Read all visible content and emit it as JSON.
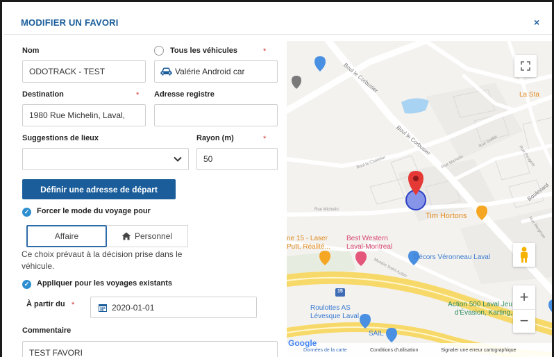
{
  "dialog": {
    "title": "MODIFIER UN FAVORI",
    "close_label": "×"
  },
  "form": {
    "nom_label": "Nom",
    "nom_value": "ODOTRACK - TEST",
    "vehicles_label": "Tous les véhicules",
    "vehicle_value": "Valérie Android car",
    "destination_label": "Destination",
    "destination_value": "1980 Rue Michelin, Laval,",
    "adresse_registre_label": "Adresse registre",
    "adresse_registre_value": "",
    "suggestions_label": "Suggestions de lieux",
    "suggestions_value": "",
    "rayon_label": "Rayon (m)",
    "rayon_value": "50",
    "depart_button": "Définir une adresse de départ",
    "force_mode_label": "Forcer le mode du voyage pour",
    "mode_affaire": "Affaire",
    "mode_personnel": "Personnel",
    "mode_note": "Ce choix prévaut à la décision prise dans le véhicule.",
    "apply_existing_label": "Appliquer pour les voyages existants",
    "a_partir_label": "À partir du",
    "a_partir_value": "2020-01-01",
    "commentaire_label": "Commentaire",
    "commentaire_value": "TEST FAVORI",
    "required_mark": "*"
  },
  "map": {
    "streets": {
      "boul_corbusier_1": "Boul le Corbusier",
      "boul_corbusier_2": "Boul le Corbusier",
      "boul_chatelier": "Boul le Chatelier",
      "rue_michelin_1": "Rue Michelin",
      "rue_michelin_2": "Rue Michelin",
      "rue_guillet": "Rue Guillet",
      "rue_peugeot": "Rue Peugeot",
      "boulevard": "Boulevard",
      "rue_bergman": "Rue Bergman",
      "montee_saint_aubin": "Montée Saint-Aubin",
      "route": "15"
    },
    "places": {
      "la_sta": "La Sta",
      "tim_hortons": "Tim Hortons",
      "laser_1": "ne 15 - Laser",
      "laser_2": "Putt, Réalité...",
      "best_western_1": "Best Western",
      "best_western_2": "Laval-Montreal",
      "decors": "Décors Véronneau Laval",
      "roulottes_1": "Roulottes AS",
      "roulottes_2": "Lévesque Laval",
      "sail": "SAIL",
      "action_1": "Action 500 Laval Jeu",
      "action_2": "d'Évasion, Karting,"
    },
    "footer": {
      "google": "Google",
      "data": "Données de la carte",
      "terms": "Conditions d'utilisation",
      "report": "Signaler une erreur cartographique"
    },
    "zoom_in": "+",
    "zoom_out": "−"
  },
  "colors": {
    "primary": "#1a5d9a",
    "accent": "#2e8fd0",
    "required": "#d03030",
    "marker": "#e53935",
    "poi_orange": "#f5a623",
    "poi_pink": "#e4567a",
    "poi_blue": "#4a90e2"
  }
}
